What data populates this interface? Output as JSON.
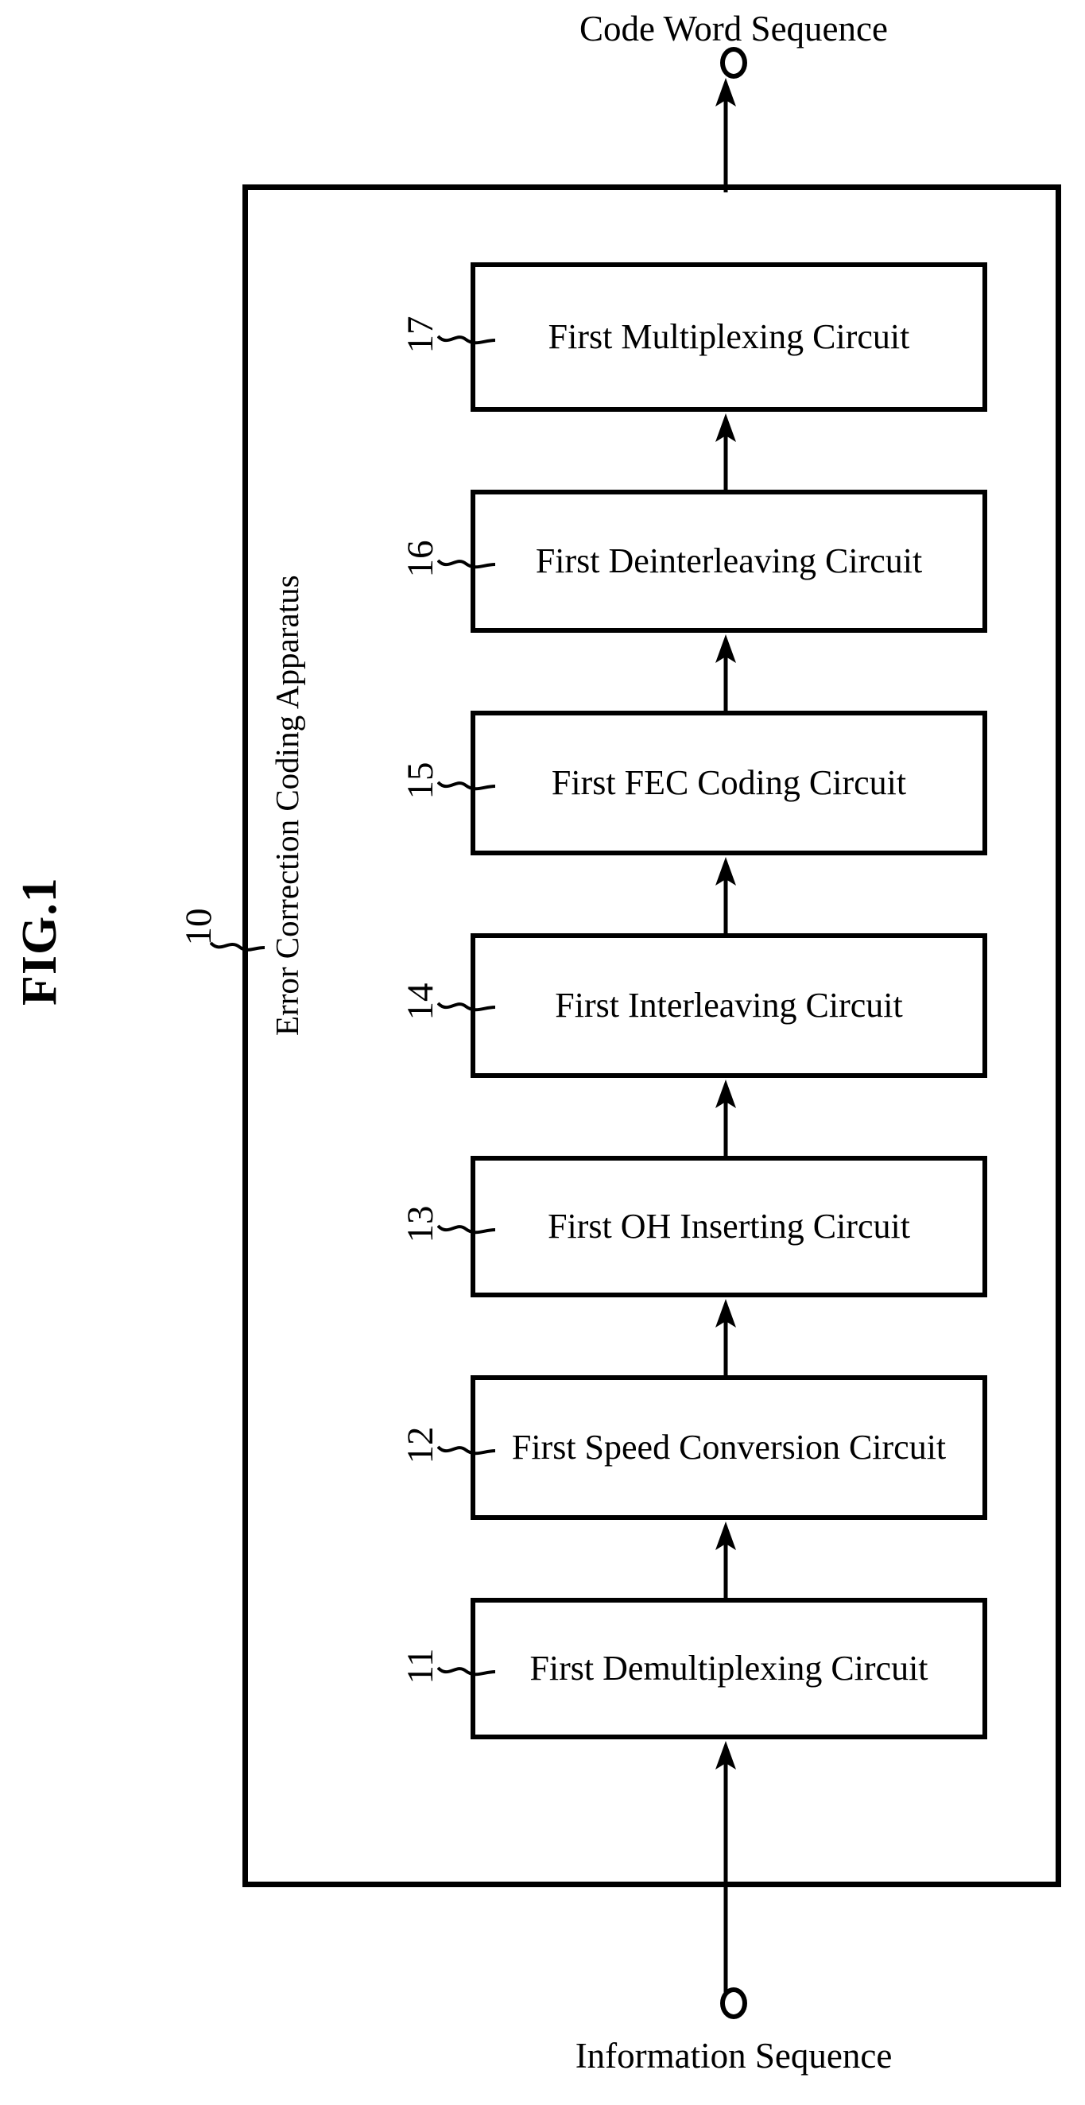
{
  "figure": {
    "number_label": "FIG.1",
    "apparatus_caption": "Error Correction Coding Apparatus",
    "apparatus_ref": "10"
  },
  "top_terminal": {
    "caption": "Code Word Sequence"
  },
  "bottom_terminal": {
    "caption": "Information Sequence"
  },
  "blocks": [
    {
      "ref": "17",
      "label": "First Multiplexing Circuit"
    },
    {
      "ref": "16",
      "label": "First Deinterleaving Circuit"
    },
    {
      "ref": "15",
      "label": "First FEC Coding Circuit"
    },
    {
      "ref": "14",
      "label": "First Interleaving Circuit"
    },
    {
      "ref": "13",
      "label": "First OH Inserting Circuit"
    },
    {
      "ref": "12",
      "label": "First Speed Conversion Circuit"
    },
    {
      "ref": "11",
      "label": "First Demultiplexing Circuit"
    }
  ],
  "colors": {
    "ink": "#000000",
    "paper": "#ffffff"
  }
}
